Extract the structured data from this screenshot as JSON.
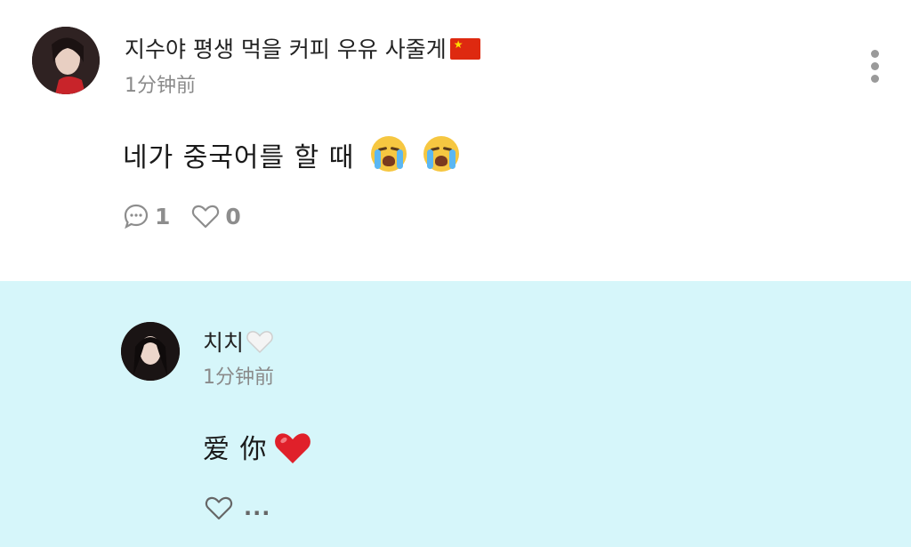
{
  "post": {
    "username": "지수야 평생 먹을 커피 우유 사줄게",
    "flag_icon": "china-flag-icon",
    "time": "1分钟前",
    "content": "네가 중국어를 할 때",
    "emoji": "loudly-crying-face-icon",
    "comment_count": "1",
    "like_count": "0"
  },
  "reply": {
    "username": "치치",
    "username_icon": "white-heart-icon",
    "time": "1分钟前",
    "content": "爱 你",
    "emoji": "red-heart-icon",
    "more_text": "..."
  },
  "colors": {
    "reply_background": "#d6f6fa",
    "secondary_text": "#8a8a8a",
    "heart_red": "#e0202a"
  }
}
